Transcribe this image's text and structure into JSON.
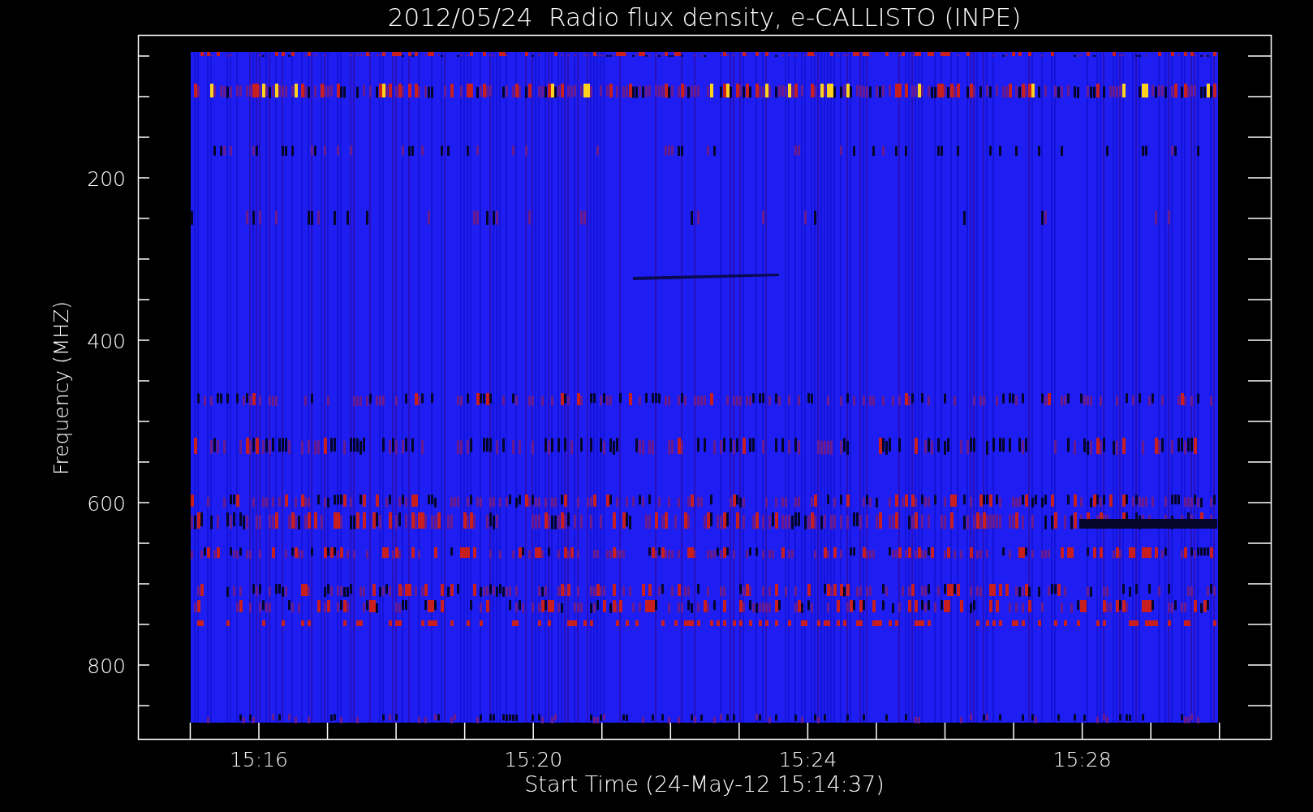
{
  "title": "2012/05/24  Radio flux density, e-CALLISTO (INPE)",
  "y_axis": {
    "label": "Frequency (MHZ)",
    "tick_labels": [
      "200",
      "400",
      "600",
      "800"
    ]
  },
  "x_axis": {
    "label": "Start Time (24-May-12 15:14:37)",
    "tick_labels": [
      "15:16",
      "15:20",
      "15:24",
      "15:28"
    ]
  }
}
